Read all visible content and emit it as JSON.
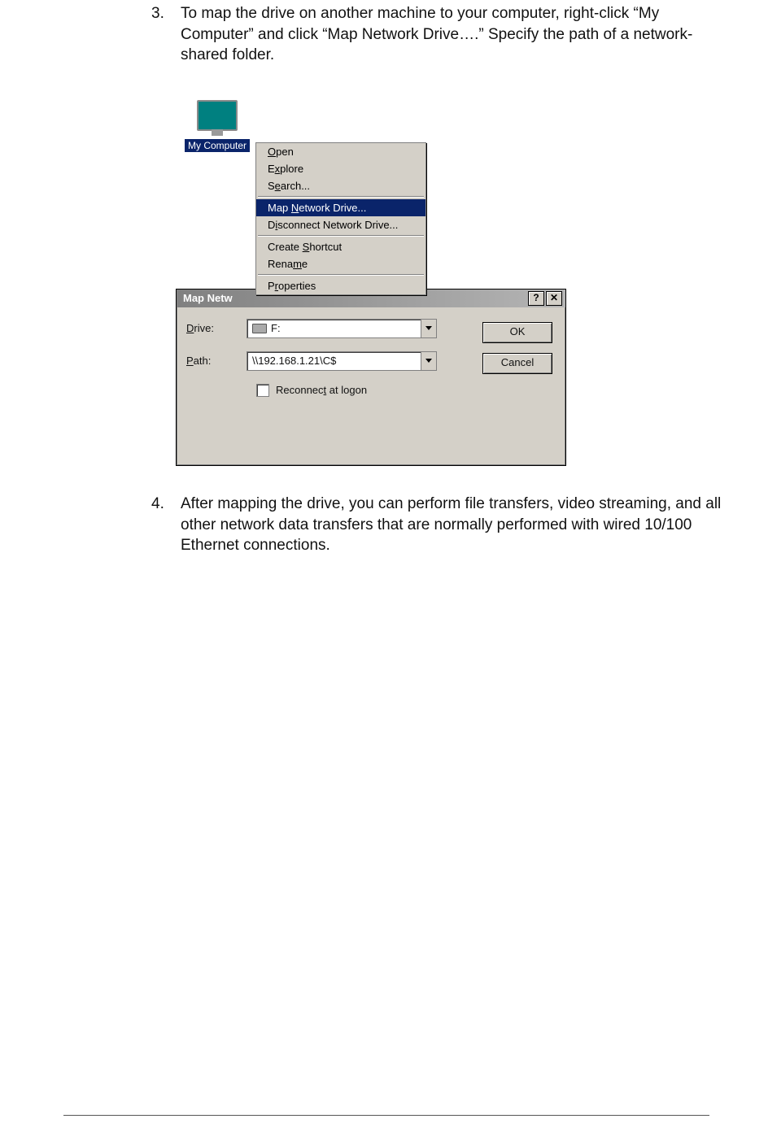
{
  "steps": {
    "s3": {
      "num": "3.",
      "text": "To map the drive on another machine to your computer, right-click “My Computer” and click “Map Network Drive….” Specify the path of a network-shared folder."
    },
    "s4": {
      "num": "4.",
      "text": "After mapping the drive, you can perform file transfers, video streaming, and all other network data transfers that are normally performed with wired 10/100 Ethernet connections."
    }
  },
  "desktop": {
    "my_computer_label": "My Computer"
  },
  "context_menu": {
    "open_pre": "",
    "open_ul": "O",
    "open_post": "pen",
    "explore_pre": "E",
    "explore_ul": "x",
    "explore_post": "plore",
    "search_pre": "S",
    "search_ul": "e",
    "search_post": "arch...",
    "map_pre": "Map ",
    "map_ul": "N",
    "map_post": "etwork Drive...",
    "disc_pre": "D",
    "disc_ul": "i",
    "disc_post": "sconnect Network Drive...",
    "shortcut_pre": "Create ",
    "shortcut_ul": "S",
    "shortcut_post": "hortcut",
    "rename_pre": "Rena",
    "rename_ul": "m",
    "rename_post": "e",
    "prop_pre": "P",
    "prop_ul": "r",
    "prop_post": "operties"
  },
  "dialog": {
    "title": "Map Netw",
    "help_btn": "?",
    "close_btn": "✕",
    "drive_pre": "",
    "drive_ul": "D",
    "drive_post": "rive:",
    "path_pre": "",
    "path_ul": "P",
    "path_post": "ath:",
    "drive_value": "F:",
    "path_value": "\\\\192.168.1.21\\C$",
    "reconnect_pre": "Reconnec",
    "reconnect_ul": "t",
    "reconnect_post": " at logon",
    "ok": "OK",
    "cancel": "Cancel"
  }
}
